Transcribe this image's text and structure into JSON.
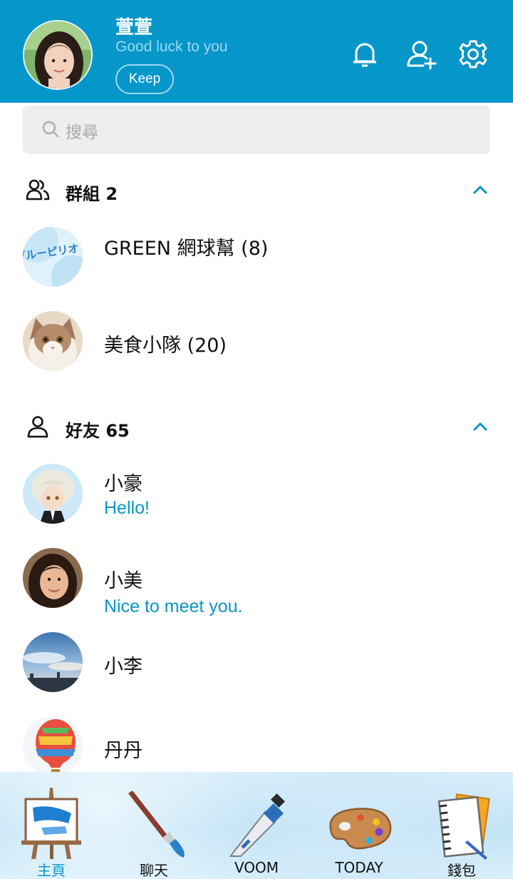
{
  "profile": {
    "name": "萱萱",
    "status": "Good luck to you",
    "keep_label": "Keep"
  },
  "header_icons": [
    "bell-icon",
    "add-friend-icon",
    "settings-gear-icon"
  ],
  "search": {
    "placeholder": "搜尋"
  },
  "groups": {
    "title": "群組 2",
    "items": [
      {
        "name": "GREEN 網球幫 (8)",
        "avatar_text": "ブルーピリオド"
      },
      {
        "name": "美食小隊 (20)"
      }
    ]
  },
  "friends": {
    "title": "好友 65",
    "items": [
      {
        "name": "小豪",
        "message": "Hello!"
      },
      {
        "name": "小美",
        "message": "Nice to meet you."
      },
      {
        "name": "小李",
        "message": ""
      },
      {
        "name": "丹丹",
        "message": ""
      }
    ]
  },
  "nav": {
    "items": [
      {
        "label": "主頁",
        "active": true
      },
      {
        "label": "聊天",
        "active": false
      },
      {
        "label": "VOOM",
        "active": false
      },
      {
        "label": "TODAY",
        "active": false
      },
      {
        "label": "錢包",
        "active": false
      }
    ]
  },
  "colors": {
    "header": "#0596CA",
    "accent": "#0A95C9",
    "search_bg": "#EEEEEE"
  }
}
